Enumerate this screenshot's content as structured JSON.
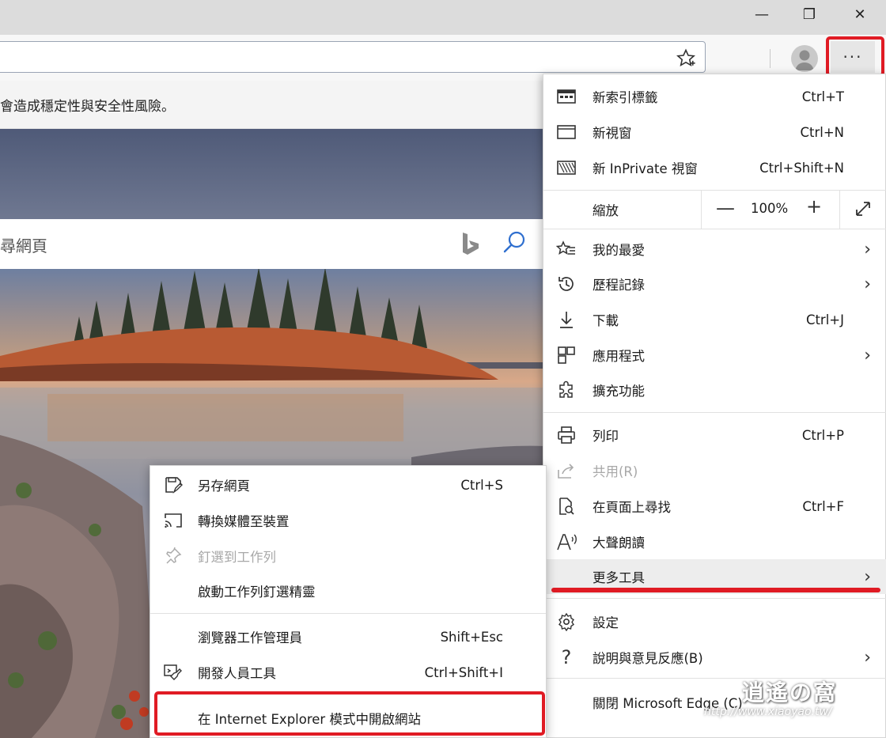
{
  "window": {
    "minimize_glyph": "—",
    "restore_glyph": "❐",
    "close_glyph": "✕"
  },
  "toolbar": {
    "more_glyph": "···"
  },
  "page": {
    "warning_text": "會造成穩定性與安全性風險。",
    "search_placeholder": "尋網頁"
  },
  "menu": {
    "items": [
      {
        "label": "新索引標籤",
        "shortcut": "Ctrl+T",
        "icon": "new-tab-icon"
      },
      {
        "label": "新視窗",
        "shortcut": "Ctrl+N",
        "icon": "new-window-icon"
      },
      {
        "label": "新 InPrivate 視窗",
        "shortcut": "Ctrl+Shift+N",
        "icon": "inprivate-icon"
      },
      {
        "label": "我的最愛",
        "shortcut": "",
        "icon": "favorites-icon"
      },
      {
        "label": "歷程記錄",
        "shortcut": "",
        "icon": "history-icon"
      },
      {
        "label": "下載",
        "shortcut": "Ctrl+J",
        "icon": "download-icon"
      },
      {
        "label": "應用程式",
        "shortcut": "",
        "icon": "apps-icon"
      },
      {
        "label": "擴充功能",
        "shortcut": "",
        "icon": "extensions-icon"
      },
      {
        "label": "列印",
        "shortcut": "Ctrl+P",
        "icon": "print-icon"
      },
      {
        "label": "共用(R)",
        "shortcut": "",
        "icon": "share-icon"
      },
      {
        "label": "在頁面上尋找",
        "shortcut": "Ctrl+F",
        "icon": "find-icon"
      },
      {
        "label": "大聲朗讀",
        "shortcut": "",
        "icon": "read-aloud-icon"
      },
      {
        "label": "更多工具",
        "shortcut": "",
        "icon": ""
      },
      {
        "label": "設定",
        "shortcut": "",
        "icon": "settings-icon"
      },
      {
        "label": "說明與意見反應(B)",
        "shortcut": "",
        "icon": "help-icon"
      },
      {
        "label": "關閉 Microsoft Edge (C)",
        "shortcut": "",
        "icon": ""
      }
    ],
    "zoom": {
      "label": "縮放",
      "value": "100%",
      "minus": "—",
      "plus": "+"
    },
    "chevron": "›"
  },
  "submenu": {
    "items": [
      {
        "label": "另存網頁",
        "shortcut": "Ctrl+S",
        "icon": "save-page-icon"
      },
      {
        "label": "轉換媒體至裝置",
        "shortcut": "",
        "icon": "cast-icon"
      },
      {
        "label": "釘選到工作列",
        "shortcut": "",
        "icon": "pin-icon"
      },
      {
        "label": "啟動工作列釘選精靈",
        "shortcut": "",
        "icon": ""
      },
      {
        "label": "瀏覽器工作管理員",
        "shortcut": "Shift+Esc",
        "icon": ""
      },
      {
        "label": "開發人員工具",
        "shortcut": "Ctrl+Shift+I",
        "icon": "devtools-icon"
      },
      {
        "label": "在 Internet Explorer 模式中開啟網站",
        "shortcut": "",
        "icon": ""
      }
    ]
  },
  "watermark": {
    "line1": "逍遙の窩",
    "line2": "http://www.xiaoyao.tw/"
  },
  "colors": {
    "highlight_red": "#e01b24",
    "menu_bg": "#ffffff",
    "hover_bg": "#ededed"
  }
}
